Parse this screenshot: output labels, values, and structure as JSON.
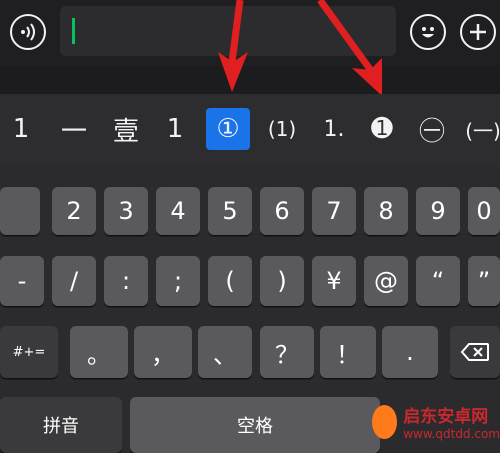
{
  "candidates": [
    "1",
    "一",
    "壹",
    "1",
    "①",
    "(1)",
    "1.",
    "➊",
    "㊀",
    "(一)"
  ],
  "selected_index": 4,
  "keys": {
    "row1": [
      "2",
      "3",
      "4",
      "5",
      "6",
      "7",
      "8",
      "9",
      "0"
    ],
    "row2": [
      "-",
      "/",
      ":",
      ";",
      "(",
      ")",
      "¥",
      "@",
      "“",
      "”"
    ],
    "row3_symbols": "#+=",
    "row3": [
      "。",
      "，",
      "、",
      "？",
      "！",
      "."
    ],
    "row4_pinyin": "拼音",
    "row4_space": "空格"
  },
  "watermark": {
    "title": "启东安卓网",
    "url": "www.qdtdd.com"
  },
  "colors": {
    "accent_caret": "#07c160",
    "selected_candidate": "#1a73e8",
    "arrow": "#e02020"
  },
  "icons": [
    "voice-icon",
    "emoji-icon",
    "plus-icon",
    "backspace-icon",
    "red-arrow-icon"
  ]
}
